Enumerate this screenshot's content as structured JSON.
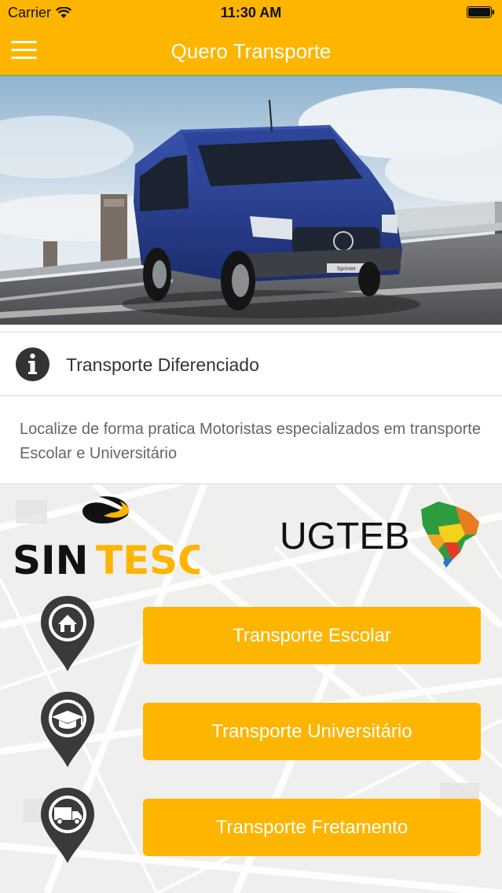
{
  "status_bar": {
    "carrier": "Carrier",
    "time": "11:30 AM"
  },
  "header": {
    "title": "Quero Transporte"
  },
  "hero": {
    "plate_text": "Sprinter"
  },
  "info": {
    "title": "Transporte Diferenciado",
    "description": "Localize de forma pratica Motoristas especializados em transporte Escolar e Universitário"
  },
  "logos": {
    "sintesc_text_dark": "SIN",
    "sintesc_text_accent": "TESC",
    "ugteb_text": "UGTEB"
  },
  "actions": [
    {
      "label": "Transporte Escolar",
      "icon": "house-icon"
    },
    {
      "label": "Transporte Universitário",
      "icon": "graduation-cap-icon"
    },
    {
      "label": "Transporte Fretamento",
      "icon": "truck-icon"
    }
  ],
  "colors": {
    "brand": "#fdb500",
    "header_border": "#7fb546",
    "pin": "#3a3a3a"
  }
}
